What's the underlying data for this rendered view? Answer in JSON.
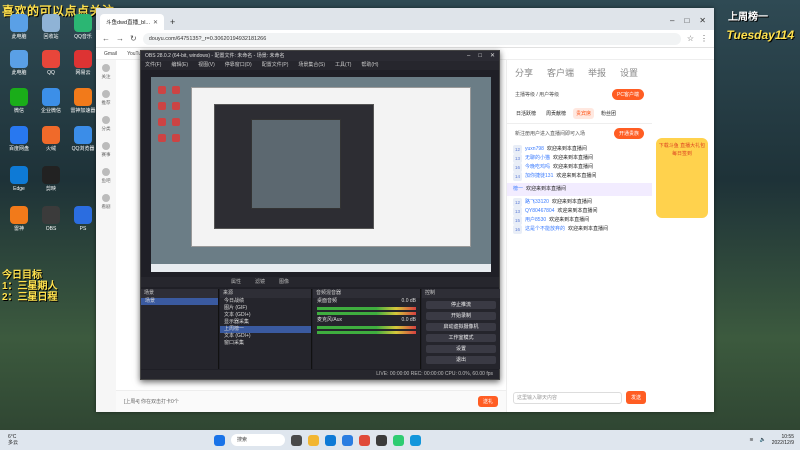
{
  "overlay": {
    "title": "喜欢的可以点点关注",
    "side_line1": "今日目标",
    "side_line2": "1：三星期人",
    "side_line3": "2：三星日程",
    "top_right": "上周榜一",
    "brand": "Tuesday114"
  },
  "desktop_icons": [
    "此电脑",
    "回收站",
    "QQ音乐",
    "此电脑",
    "QQ",
    "网易云",
    "微信",
    "企业微信",
    "雷神加速器",
    "百度网盘",
    "火绒",
    "QQ浏览器",
    "Edge",
    "剪映",
    "雷神",
    "OBS",
    "PS"
  ],
  "browser": {
    "tab_title": "斗鱼dwd直播_bl...",
    "url": "douyu.com/6475135?_r=0.30620194932181266",
    "bookmarks": [
      "Gmail",
      "YouTube",
      "地图",
      "新鲜dwd直播剑...",
      "bap123_1 精灵",
      "地址合"
    ]
  },
  "douyu": {
    "left_nav": [
      "关注",
      "推荐",
      "分类",
      "赛事",
      "鱼吧",
      "看剧"
    ],
    "rp_top_icons": [
      "分享",
      "客户端",
      "举报",
      "设置"
    ],
    "rp_row1_label": "主播等级 / 用户等级",
    "pc_button": "PC客户端",
    "tabs": [
      "日活跃榜",
      "周贡献榜",
      "贵宾席",
      "粉丝团"
    ],
    "subscribe": "开通贵族",
    "notice": "新注册用户进入直播间即可入场",
    "messages": [
      {
        "lvl": "12",
        "name": "yuxn798",
        "text": "欢迎来到本直播间"
      },
      {
        "lvl": "13",
        "name": "无聊的小猫",
        "text": "欢迎来到本直播间"
      },
      {
        "lvl": "16",
        "name": "今晚吃鸡吗",
        "text": "欢迎来到本直播间"
      },
      {
        "lvl": "14",
        "name": "加你捷徒131",
        "text": "欢迎来到本直播间"
      }
    ],
    "highlight": {
      "name": "榜一",
      "text": "欢迎来到本直播间"
    },
    "messages2": [
      {
        "lvl": "12",
        "name": "路飞33120",
        "text": "欢迎来到本直播间"
      },
      {
        "lvl": "13",
        "name": "QY80467804",
        "text": "欢迎来到本直播间"
      },
      {
        "lvl": "15",
        "name": "用户8530",
        "text": "欢迎来到本直播间"
      },
      {
        "lvl": "16",
        "name": "这是个不能放弃的",
        "text": "欢迎来到本直播间"
      }
    ],
    "send_placeholder": "这里输入聊天内容",
    "send_btn": "发送",
    "promo_text": "下载斗鱼 直播大礼包 每日签到",
    "bottom_text": "[上周4] 你在双击打卡0个",
    "bottom_btn": "送礼"
  },
  "obs": {
    "title": "OBS 28.0.2 (64-bit, windows) - 配置文件: 未命名 - 场景: 未命名",
    "menu": [
      "文件(F)",
      "编辑(E)",
      "视图(V)",
      "停靠窗口(D)",
      "配置文件(P)",
      "场景集合(S)",
      "工具(T)",
      "帮助(H)"
    ],
    "ctrl_bar": [
      "属性",
      "滤镜",
      "图像"
    ],
    "docks": {
      "scenes": "场景",
      "sources": "来源",
      "mixer": "音频混音器",
      "transitions": "场景转场",
      "controls": "控制"
    },
    "scene_items": [
      "场景"
    ],
    "source_items": [
      "今日战绩",
      "图片 (GIF)",
      "文本 (GDI+)",
      "显示器采集",
      "上周榜一",
      "文本 (GDI+)",
      "窗口采集"
    ],
    "mixer_items": [
      {
        "name": "桌面音频",
        "db": "0.0 dB"
      },
      {
        "name": "麦克风/Aux",
        "db": "0.0 dB"
      }
    ],
    "controls": [
      "停止推流",
      "开始录制",
      "启动虚拟摄像机",
      "工作室模式",
      "设置",
      "退出"
    ],
    "status": "LIVE: 00:00:00   REC: 00:00:00   CPU: 0.0%, 60.00 fps"
  },
  "taskbar": {
    "weather_temp": "6°C",
    "weather_desc": "多云",
    "search": "搜索",
    "time": "10:55",
    "date": "2022/12/9"
  }
}
